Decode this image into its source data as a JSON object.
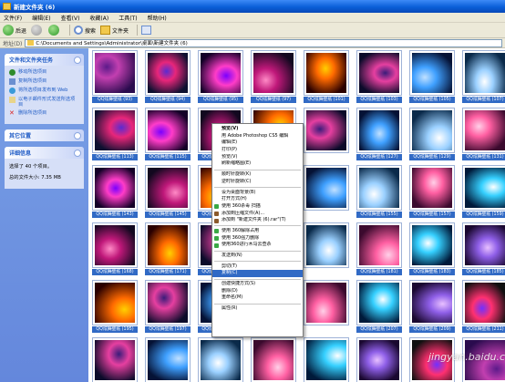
{
  "window": {
    "title": "新建文件夹 (6)"
  },
  "menubar": [
    "文件(F)",
    "编辑(E)",
    "查看(V)",
    "收藏(A)",
    "工具(T)",
    "帮助(H)"
  ],
  "toolbar": {
    "back": "后退",
    "search": "搜索",
    "folders": "文件夹"
  },
  "address": {
    "label": "地址(D)",
    "path": "C:\\Documents and Settings\\Administrator\\桌面\\新建文件夹 (6)"
  },
  "sidebar": {
    "tasks_title": "文件和文件夹任务",
    "tasks": [
      "移动所选项目",
      "复制所选项目",
      "将所选项目发布到 Web",
      "以电子邮件形式发送所选项目",
      "删除所选项目"
    ],
    "other_title": "其它位置",
    "details_title": "详细信息",
    "details": [
      "选择了 40 个项目。",
      "总的文件大小: 7.35 MB"
    ]
  },
  "thumbnails": {
    "label_prefix": "QQ炫舞壁纸",
    "row1": [
      "QQ炫舞壁纸 (93)",
      "QQ炫舞壁纸 (94)",
      "QQ炫舞壁纸 (95)",
      "QQ炫舞壁纸 (97)",
      "QQ炫舞壁纸 (101)",
      "QQ炫舞壁纸 (103)",
      "QQ炫舞壁纸 (105)",
      "QQ炫舞壁纸 (107)"
    ],
    "row2": [
      "QQ炫舞壁纸 (113)",
      "QQ炫舞壁纸 (115)",
      "QQ炫舞壁纸 (117)",
      "",
      "",
      "QQ炫舞壁纸 (127)",
      "QQ炫舞壁纸 (129)",
      "QQ炫舞壁纸 (131)"
    ],
    "row3": [
      "QQ炫舞壁纸 (143)",
      "QQ炫舞壁纸 (145)",
      "QQ炫舞壁纸 (147)",
      "",
      "",
      "QQ炫舞壁纸 (155)",
      "QQ炫舞壁纸 (157)",
      "QQ炫舞壁纸 (159)"
    ],
    "row4": [
      "QQ炫舞壁纸 (168)",
      "QQ炫舞壁纸 (171)",
      "QQ炫舞壁纸 (173)",
      "",
      "",
      "QQ炫舞壁纸 (181)",
      "QQ炫舞壁纸 (183)",
      "QQ炫舞壁纸 (185)"
    ],
    "row5": [
      "QQ炫舞壁纸 (195)",
      "QQ炫舞壁纸 (197)",
      "QQ炫舞壁纸 (199)",
      "",
      "",
      "QQ炫舞壁纸 (207)",
      "QQ炫舞壁纸 (209)",
      "QQ炫舞壁纸 (211)"
    ],
    "row6": [
      "QQ炫舞壁纸 (223)",
      "QQ炫舞壁纸 (225)",
      "QQ炫舞壁纸 (227)",
      "",
      "",
      "QQ炫舞壁纸 (235)",
      "QQ炫舞壁纸 (237)",
      "QQ炫舞壁纸 (239)"
    ]
  },
  "context_menu": [
    {
      "label": "预览(V)",
      "bold": true
    },
    {
      "label": "用 Adobe Photoshop CS5 编辑"
    },
    {
      "label": "编辑(E)"
    },
    {
      "label": "打印(P)"
    },
    {
      "label": "预览(V)"
    },
    {
      "label": "刷新缩略图(E)"
    },
    {
      "sep": true
    },
    {
      "label": "顺时针旋转(K)"
    },
    {
      "label": "逆时针旋转(C)"
    },
    {
      "sep": true
    },
    {
      "label": "设为桌面背景(B)"
    },
    {
      "label": "打开方式(H)"
    },
    {
      "label": "使用 360杀毒 扫描",
      "icon": "#3aa845"
    },
    {
      "label": "添加到压缩文件(A)...",
      "icon": "#8b5a2b"
    },
    {
      "label": "添加到 \"新建文件夹 (6).rar\"(T)",
      "icon": "#8b5a2b"
    },
    {
      "sep": true
    },
    {
      "label": "使用 360解除占用",
      "icon": "#3aa845"
    },
    {
      "label": "使用 360强力删除",
      "icon": "#3aa845"
    },
    {
      "label": "使用360进行木马云查杀",
      "icon": "#3aa845"
    },
    {
      "sep": true
    },
    {
      "label": "发送到(N)"
    },
    {
      "sep": true
    },
    {
      "label": "剪切(T)"
    },
    {
      "label": "复制(C)",
      "selected": true
    },
    {
      "sep": true
    },
    {
      "label": "创建快捷方式(S)"
    },
    {
      "label": "删除(D)"
    },
    {
      "label": "重命名(M)"
    },
    {
      "sep": true
    },
    {
      "label": "属性(R)"
    }
  ],
  "watermark": "jingyan.baidu.com",
  "colors": {
    "title_blue": "#0a5fd8",
    "selection_blue": "#316ac5",
    "sidebar_blue": "#6487dc"
  }
}
